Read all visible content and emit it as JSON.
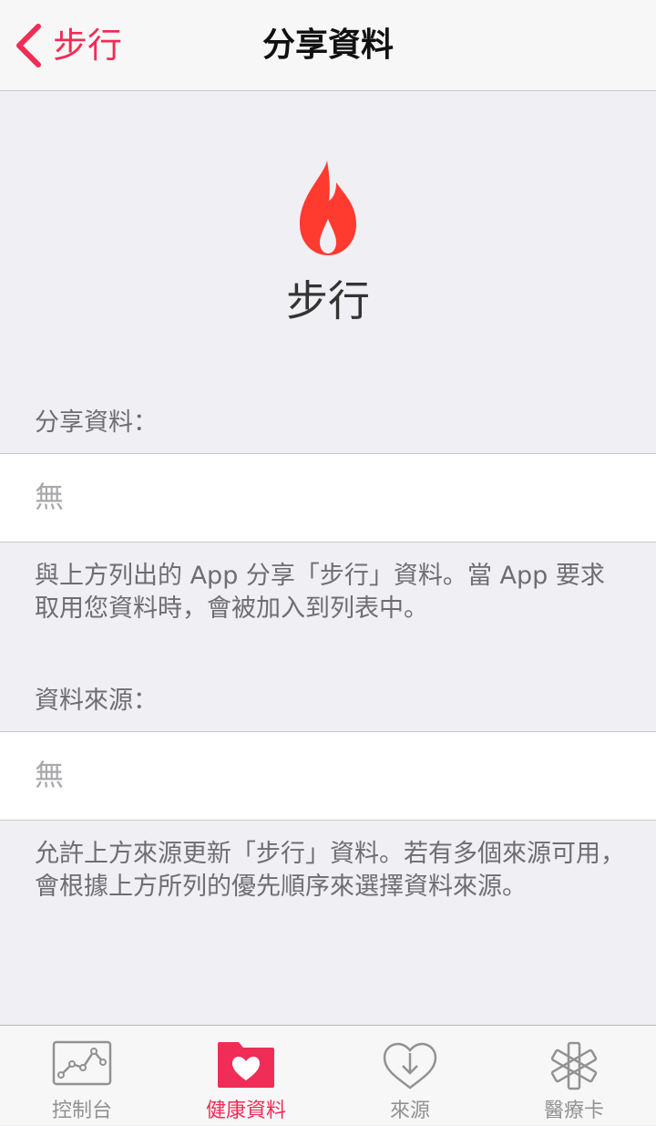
{
  "colors": {
    "accent": "#ef2d56",
    "flame": "#ff3b30",
    "background": "#efeff4"
  },
  "navbar": {
    "back_label": "步行",
    "title": "分享資料"
  },
  "header": {
    "icon": "flame-icon",
    "title": "步行"
  },
  "share_section": {
    "header": "分享資料：",
    "value": "無",
    "footer": "與上方列出的 App 分享「步行」資料。當 App 要求取用您資料時，會被加入到列表中。"
  },
  "sources_section": {
    "header": "資料來源：",
    "value": "無",
    "footer": "允許上方來源更新「步行」資料。若有多個來源可用，會根據上方所列的優先順序來選擇資料來源。"
  },
  "tabbar": {
    "tabs": [
      {
        "label": "控制台",
        "icon": "dashboard-icon",
        "active": false
      },
      {
        "label": "健康資料",
        "icon": "health-data-folder-icon",
        "active": true
      },
      {
        "label": "來源",
        "icon": "sources-download-icon",
        "active": false
      },
      {
        "label": "醫療卡",
        "icon": "medical-id-icon",
        "active": false
      }
    ]
  }
}
